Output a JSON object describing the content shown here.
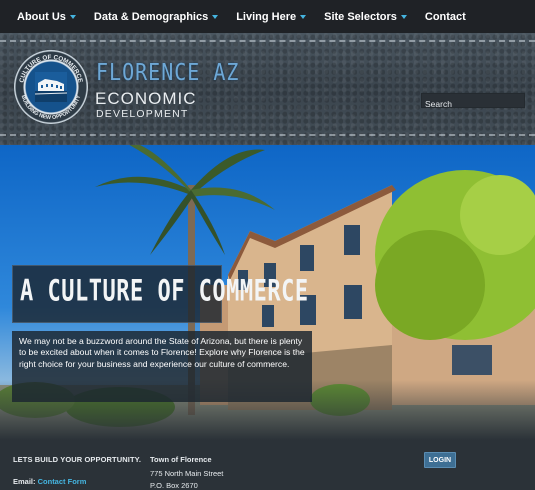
{
  "nav": {
    "items": [
      {
        "label": "About Us",
        "dropdown": true
      },
      {
        "label": "Data & Demographics",
        "dropdown": true
      },
      {
        "label": "Living Here",
        "dropdown": true
      },
      {
        "label": "Site Selectors",
        "dropdown": true
      },
      {
        "label": "Contact",
        "dropdown": false
      }
    ]
  },
  "header": {
    "seal_text_top": "CULTURE OF COMMERCE",
    "seal_text_bottom": "BUILDING NEW OPPORTUNITY",
    "brand_top": "FLORENCE AZ",
    "brand_main": "ECONOMIC",
    "brand_sub": "DEVELOPMENT",
    "search_placeholder": "Search"
  },
  "hero": {
    "title": "A CULTURE OF COMMERCE",
    "text": "We may not be a buzzword around the State of Arizona, but there is plenty to be excited about when it comes to Florence!  Explore why Florence is the right choice for your business and experience our culture of commerce."
  },
  "footer": {
    "tagline": "LETS BUILD YOUR OPPORTUNITY.",
    "email_label": "Email:",
    "email_link": "Contact Form",
    "org_name": "Town of Florence",
    "address_line1": "775 North Main Street",
    "address_line2": "P.O. Box 2670",
    "login_label": "LOGIN"
  },
  "colors": {
    "accent": "#45b5e0",
    "nav_bg": "#1f2226",
    "footer_bg": "#2b3238",
    "brand_blue": "#6ea8d6",
    "login_bg": "#3e6f94"
  }
}
